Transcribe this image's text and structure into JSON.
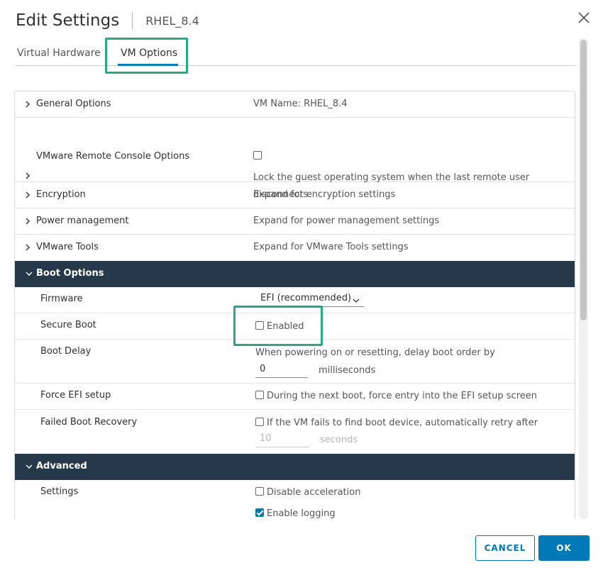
{
  "dialog": {
    "title": "Edit Settings",
    "subtitle": "RHEL_8.4"
  },
  "tabs": [
    {
      "label": "Virtual Hardware",
      "active": false
    },
    {
      "label": "VM Options",
      "active": true
    }
  ],
  "rows": {
    "general": {
      "label": "General Options",
      "value": "VM Name: RHEL_8.4"
    },
    "console": {
      "label": "VMware Remote Console Options",
      "checked": false,
      "checkbox_text": "Lock the guest operating system when the last remote user disconnects"
    },
    "encryption": {
      "label": "Encryption",
      "value": "Expand for encryption settings"
    },
    "power": {
      "label": "Power management",
      "value": "Expand for power management settings"
    },
    "tools": {
      "label": "VMware Tools",
      "value": "Expand for VMware Tools settings"
    }
  },
  "boot": {
    "header": "Boot Options",
    "firmware": {
      "label": "Firmware",
      "selected": "EFI (recommended)"
    },
    "secure_boot": {
      "label": "Secure Boot",
      "checkbox_label": "Enabled",
      "checked": false
    },
    "boot_delay": {
      "label": "Boot Delay",
      "description": "When powering on or resetting, delay boot order by",
      "value": "0",
      "unit": "milliseconds"
    },
    "force_efi": {
      "label": "Force EFI setup",
      "checkbox_label": "During the next boot, force entry into the EFI setup screen",
      "checked": false
    },
    "failed_recovery": {
      "label": "Failed Boot Recovery",
      "checkbox_label": "If the VM fails to find boot device, automatically retry after",
      "checked": false,
      "value": "10",
      "unit": "seconds"
    }
  },
  "advanced": {
    "header": "Advanced",
    "settings": {
      "label": "Settings",
      "disable_acceleration": "Disable acceleration",
      "disable_acceleration_checked": false,
      "enable_logging": "Enable logging",
      "enable_logging_checked": true
    }
  },
  "buttons": {
    "cancel": "CANCEL",
    "ok": "OK"
  },
  "colors": {
    "accent": "#0079b8",
    "header_bg": "#25394a",
    "highlight": "#2aa785"
  }
}
